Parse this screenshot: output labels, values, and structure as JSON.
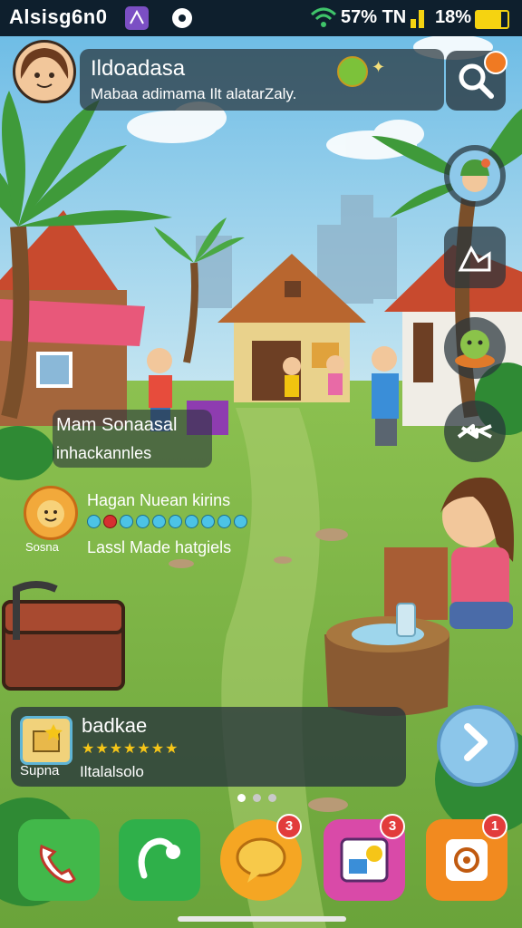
{
  "status_bar": {
    "title": "Alsisg6n0",
    "battery_pct": "57% TN",
    "time": "18%",
    "battery_level": 0.8,
    "icons": [
      "app-icon",
      "notification-icon",
      "wifi-icon",
      "signal-icon",
      "battery-icon"
    ]
  },
  "header": {
    "title": "Ildoadasa",
    "subtitle": "Mabaa adimama Ilt alatarZaly.",
    "icons": [
      "avatar-icon",
      "fruit-icon",
      "sparkle-icon",
      "search-icon",
      "notification-badge"
    ]
  },
  "side_buttons": {
    "icons": [
      "friend-avatar-icon",
      "chart-icon",
      "creature-icon",
      "arrows-icon"
    ]
  },
  "npc": {
    "name": "Mam Sonaasal",
    "role": "inhackannles"
  },
  "quest": {
    "title": "Hagan Nuean kirins",
    "icon_label": "Sosna",
    "description": "Lassl Made hatgiels",
    "progress_dots": 10,
    "red_dot_index": 1
  },
  "bottom_card": {
    "title": "badkae",
    "icon_label": "Supna",
    "description": "Iltalalsolo",
    "stars": 7
  },
  "pager": {
    "pages": 3,
    "active_index": 0
  },
  "dock": {
    "items": [
      {
        "name": "phone",
        "icon": "phone-icon",
        "color": "#42b84a",
        "badge": ""
      },
      {
        "name": "headset",
        "icon": "headset-icon",
        "color": "#2fb04a",
        "badge": ""
      },
      {
        "name": "chat",
        "icon": "chat-icon",
        "color": "#f5a623",
        "badge": "3"
      },
      {
        "name": "gallery",
        "icon": "gallery-icon",
        "color": "#d94aa8",
        "badge": "3"
      },
      {
        "name": "settings",
        "icon": "settings-icon",
        "color": "#f28a1f",
        "badge": "1"
      }
    ]
  },
  "colors": {
    "sky": "#7cc3e6",
    "grass": "#7fb548",
    "panel": "#28343c",
    "accent": "#f5c518"
  }
}
